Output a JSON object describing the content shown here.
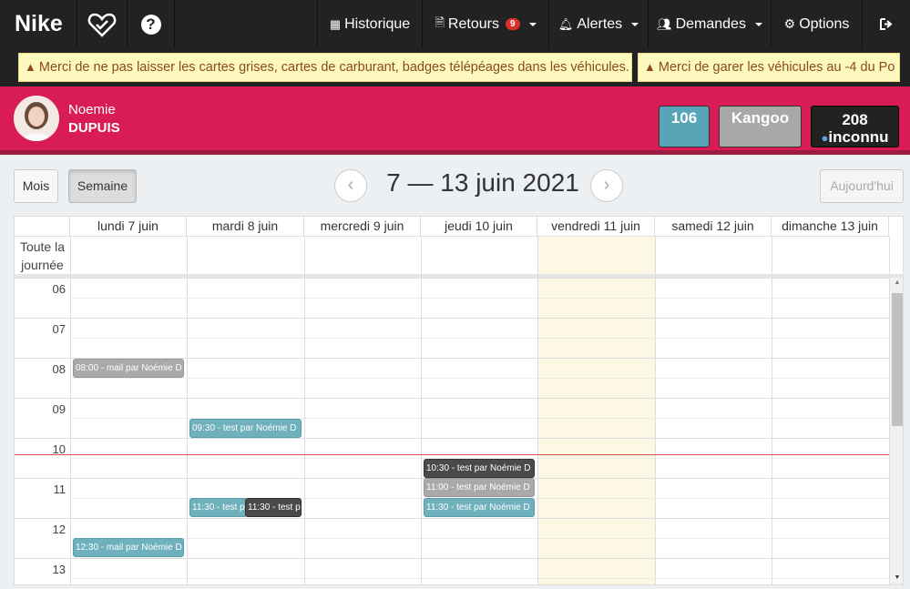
{
  "navbar": {
    "brand": "Nike",
    "items": [
      {
        "label": "Historique",
        "icon": "table-icon"
      },
      {
        "label": "Retours",
        "icon": "file-icon",
        "badge": "9"
      },
      {
        "label": "Alertes",
        "icon": "bell-icon"
      },
      {
        "label": "Demandes",
        "icon": "users-icon"
      },
      {
        "label": "Options",
        "icon": "gear-icon"
      }
    ]
  },
  "alerts": [
    "Merci de ne pas laisser les cartes grises, cartes de carburant, badges télépéages dans les véhicules.",
    "Merci de garer les véhicules au -4 du Po"
  ],
  "driver": {
    "first_name": "Noemie",
    "last_name": "DUPUIS",
    "box1": "106",
    "box2": "Kangoo",
    "box3_top": "208",
    "box3_bottom": "inconnu"
  },
  "toolbar": {
    "month": "Mois",
    "week": "Semaine",
    "title": "7 — 13 juin 2021",
    "today": "Aujourd'hui"
  },
  "calendar": {
    "days": [
      "lundi 7 juin",
      "mardi 8 juin",
      "mercredi 9 juin",
      "jeudi 10 juin",
      "vendredi 11 juin",
      "samedi 12 juin",
      "dimanche 13 juin"
    ],
    "allday_label": "Toute la journée",
    "hours": [
      "06",
      "07",
      "08",
      "09",
      "10",
      "11",
      "12",
      "13"
    ],
    "events": [
      {
        "day": 0,
        "label": "08:00 - mail par Noémie D",
        "style": "gray"
      },
      {
        "day": 1,
        "label": "09:30 - test par Noémie D",
        "style": "blue"
      },
      {
        "day": 3,
        "label": "10:30 - test par Noémie D",
        "style": "dark"
      },
      {
        "day": 3,
        "label": "11:00 - test par Noémie D",
        "style": "gray"
      },
      {
        "day": 3,
        "label": "11:30 - test par Noémie D",
        "style": "blue"
      },
      {
        "day": 1,
        "label": "11:30 - test p",
        "style": "blue"
      },
      {
        "day": 1,
        "label": "11:30 - test p",
        "style": "dark"
      },
      {
        "day": 0,
        "label": "12:30 - mail par Noémie D",
        "style": "blue"
      }
    ]
  },
  "colors": {
    "navbar": "#222222",
    "driver_bar": "#d91b56",
    "today_column": "#fcf8e3",
    "now_line": "#d9534f"
  }
}
